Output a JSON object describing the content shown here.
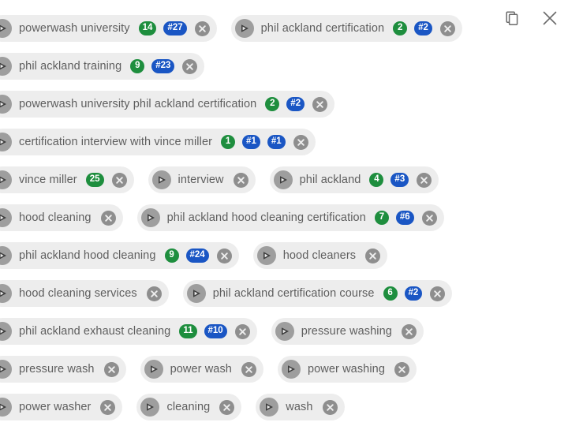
{
  "window": {
    "copy_icon": "copy-icon",
    "close_icon": "close-icon"
  },
  "colors": {
    "chip_background": "#ededed",
    "chip_text": "#5e5e5e",
    "badge_green": "#1e8e3e",
    "badge_blue": "#1a56c4",
    "icon_circle": "#9e9e9e",
    "close_circle": "#8e8e8e",
    "page_background": "#ffffff"
  },
  "chip_rows": [
    {
      "chips": [
        {
          "icon": "video-play-icon",
          "label": "powerwash university",
          "badges": [
            {
              "text": "14",
              "color": "green"
            },
            {
              "text": "#27",
              "color": "blue"
            }
          ],
          "close": "remove-chip-icon"
        },
        {
          "icon": "video-play-icon",
          "label": "phil ackland certification",
          "badges": [
            {
              "text": "2",
              "color": "green"
            },
            {
              "text": "#2",
              "color": "blue"
            }
          ],
          "close": "remove-chip-icon"
        }
      ]
    },
    {
      "chips": [
        {
          "icon": "video-play-icon",
          "label": "phil ackland training",
          "badges": [
            {
              "text": "9",
              "color": "green"
            },
            {
              "text": "#23",
              "color": "blue"
            }
          ],
          "close": "remove-chip-icon"
        }
      ]
    },
    {
      "chips": [
        {
          "icon": "video-play-icon",
          "label": "powerwash university phil ackland certification",
          "badges": [
            {
              "text": "2",
              "color": "green"
            },
            {
              "text": "#2",
              "color": "blue"
            }
          ],
          "close": "remove-chip-icon"
        }
      ]
    },
    {
      "chips": [
        {
          "icon": "video-play-icon",
          "label": "certification interview with vince miller",
          "badges": [
            {
              "text": "1",
              "color": "green"
            },
            {
              "text": "#1",
              "color": "blue"
            },
            {
              "text": "#1",
              "color": "blue"
            }
          ],
          "close": "remove-chip-icon"
        }
      ]
    },
    {
      "chips": [
        {
          "icon": "video-play-icon",
          "label": "vince miller",
          "badges": [
            {
              "text": "25",
              "color": "green"
            }
          ],
          "close": "remove-chip-icon"
        },
        {
          "icon": "video-play-icon",
          "label": "interview",
          "badges": [],
          "close": "remove-chip-icon"
        },
        {
          "icon": "video-play-icon",
          "label": "phil ackland",
          "badges": [
            {
              "text": "4",
              "color": "green"
            },
            {
              "text": "#3",
              "color": "blue"
            }
          ],
          "close": "remove-chip-icon"
        }
      ]
    },
    {
      "chips": [
        {
          "icon": "video-play-icon",
          "label": "hood cleaning",
          "badges": [],
          "close": "remove-chip-icon"
        },
        {
          "icon": "video-play-icon",
          "label": "phil ackland hood cleaning certification",
          "badges": [
            {
              "text": "7",
              "color": "green"
            },
            {
              "text": "#6",
              "color": "blue"
            }
          ],
          "close": "remove-chip-icon"
        }
      ]
    },
    {
      "chips": [
        {
          "icon": "video-play-icon",
          "label": "phil ackland hood cleaning",
          "badges": [
            {
              "text": "9",
              "color": "green"
            },
            {
              "text": "#24",
              "color": "blue"
            }
          ],
          "close": "remove-chip-icon"
        },
        {
          "icon": "video-play-icon",
          "label": "hood cleaners",
          "badges": [],
          "close": "remove-chip-icon"
        }
      ]
    },
    {
      "chips": [
        {
          "icon": "video-play-icon",
          "label": "hood cleaning services",
          "badges": [],
          "close": "remove-chip-icon"
        },
        {
          "icon": "video-play-icon",
          "label": "phil ackland certification course",
          "badges": [
            {
              "text": "6",
              "color": "green"
            },
            {
              "text": "#2",
              "color": "blue"
            }
          ],
          "close": "remove-chip-icon"
        }
      ]
    },
    {
      "chips": [
        {
          "icon": "video-play-icon",
          "label": "phil ackland exhaust cleaning",
          "badges": [
            {
              "text": "11",
              "color": "green"
            },
            {
              "text": "#10",
              "color": "blue"
            }
          ],
          "close": "remove-chip-icon"
        },
        {
          "icon": "video-play-icon",
          "label": "pressure washing",
          "badges": [],
          "close": "remove-chip-icon"
        }
      ]
    },
    {
      "chips": [
        {
          "icon": "video-play-icon",
          "label": "pressure wash",
          "badges": [],
          "close": "remove-chip-icon"
        },
        {
          "icon": "video-play-icon",
          "label": "power wash",
          "badges": [],
          "close": "remove-chip-icon"
        },
        {
          "icon": "video-play-icon",
          "label": "power washing",
          "badges": [],
          "close": "remove-chip-icon"
        }
      ]
    },
    {
      "chips": [
        {
          "icon": "video-play-icon",
          "label": "power washer",
          "badges": [],
          "close": "remove-chip-icon"
        },
        {
          "icon": "video-play-icon",
          "label": "cleaning",
          "badges": [],
          "close": "remove-chip-icon"
        },
        {
          "icon": "video-play-icon",
          "label": "wash",
          "badges": [],
          "close": "remove-chip-icon"
        }
      ]
    }
  ]
}
